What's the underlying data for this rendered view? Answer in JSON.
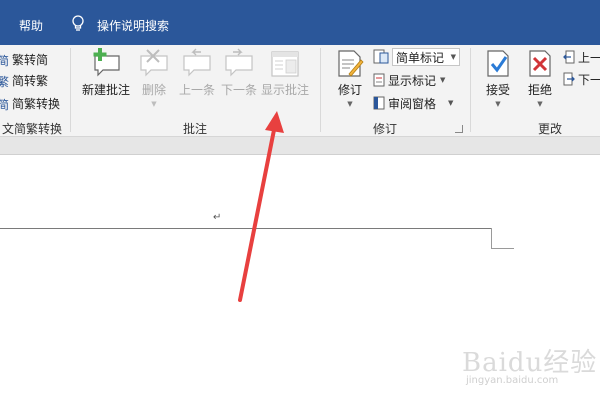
{
  "topbar": {
    "help_tab": "帮助",
    "tell_me": "操作说明搜索"
  },
  "chinese_group": {
    "trad_btn": "繁转简",
    "simp_btn": "简转繁",
    "convert_btn": "简繁转换",
    "label": "文简繁转换"
  },
  "comments_group": {
    "new_comment": "新建批注",
    "delete": "删除",
    "previous": "上一条",
    "next": "下一条",
    "show_comments": "显示批注",
    "label": "批注"
  },
  "tracking_group": {
    "track_changes": "修订",
    "markup_select": "简单标记",
    "show_markup": "显示标记",
    "reviewing_pane": "审阅窗格",
    "label": "修订"
  },
  "changes_group": {
    "accept": "接受",
    "reject": "拒绝",
    "previous": "上一",
    "next": "下一",
    "label": "更改"
  },
  "colors": {
    "accent": "#2b579a",
    "arrow": "#e8403f",
    "accept_icon": "#2b7bd6",
    "reject_icon": "#d13438"
  },
  "document": {
    "paragraph_mark": "↵"
  },
  "watermark": {
    "logo": "Baidu经验",
    "url": "jingyan.baidu.com"
  }
}
